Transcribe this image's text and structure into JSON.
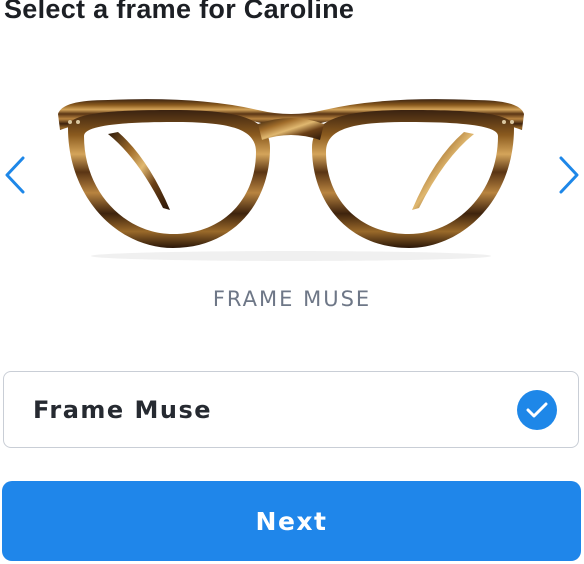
{
  "header": {
    "title": "Select a frame for Caroline"
  },
  "carousel": {
    "prev_icon": "chevron-left-icon",
    "next_icon": "chevron-right-icon",
    "frame_image": "tortoiseshell-eyeglasses",
    "frame_caption": "FRAME MUSE"
  },
  "selection": {
    "option_label": "Frame Muse",
    "selected": true,
    "check_icon": "checkmark-circle-icon"
  },
  "actions": {
    "next_label": "Next"
  },
  "colors": {
    "accent": "#1f86ea",
    "border": "#c9ced6",
    "caption_text": "#6e7787",
    "title_text": "#1c1f24"
  }
}
